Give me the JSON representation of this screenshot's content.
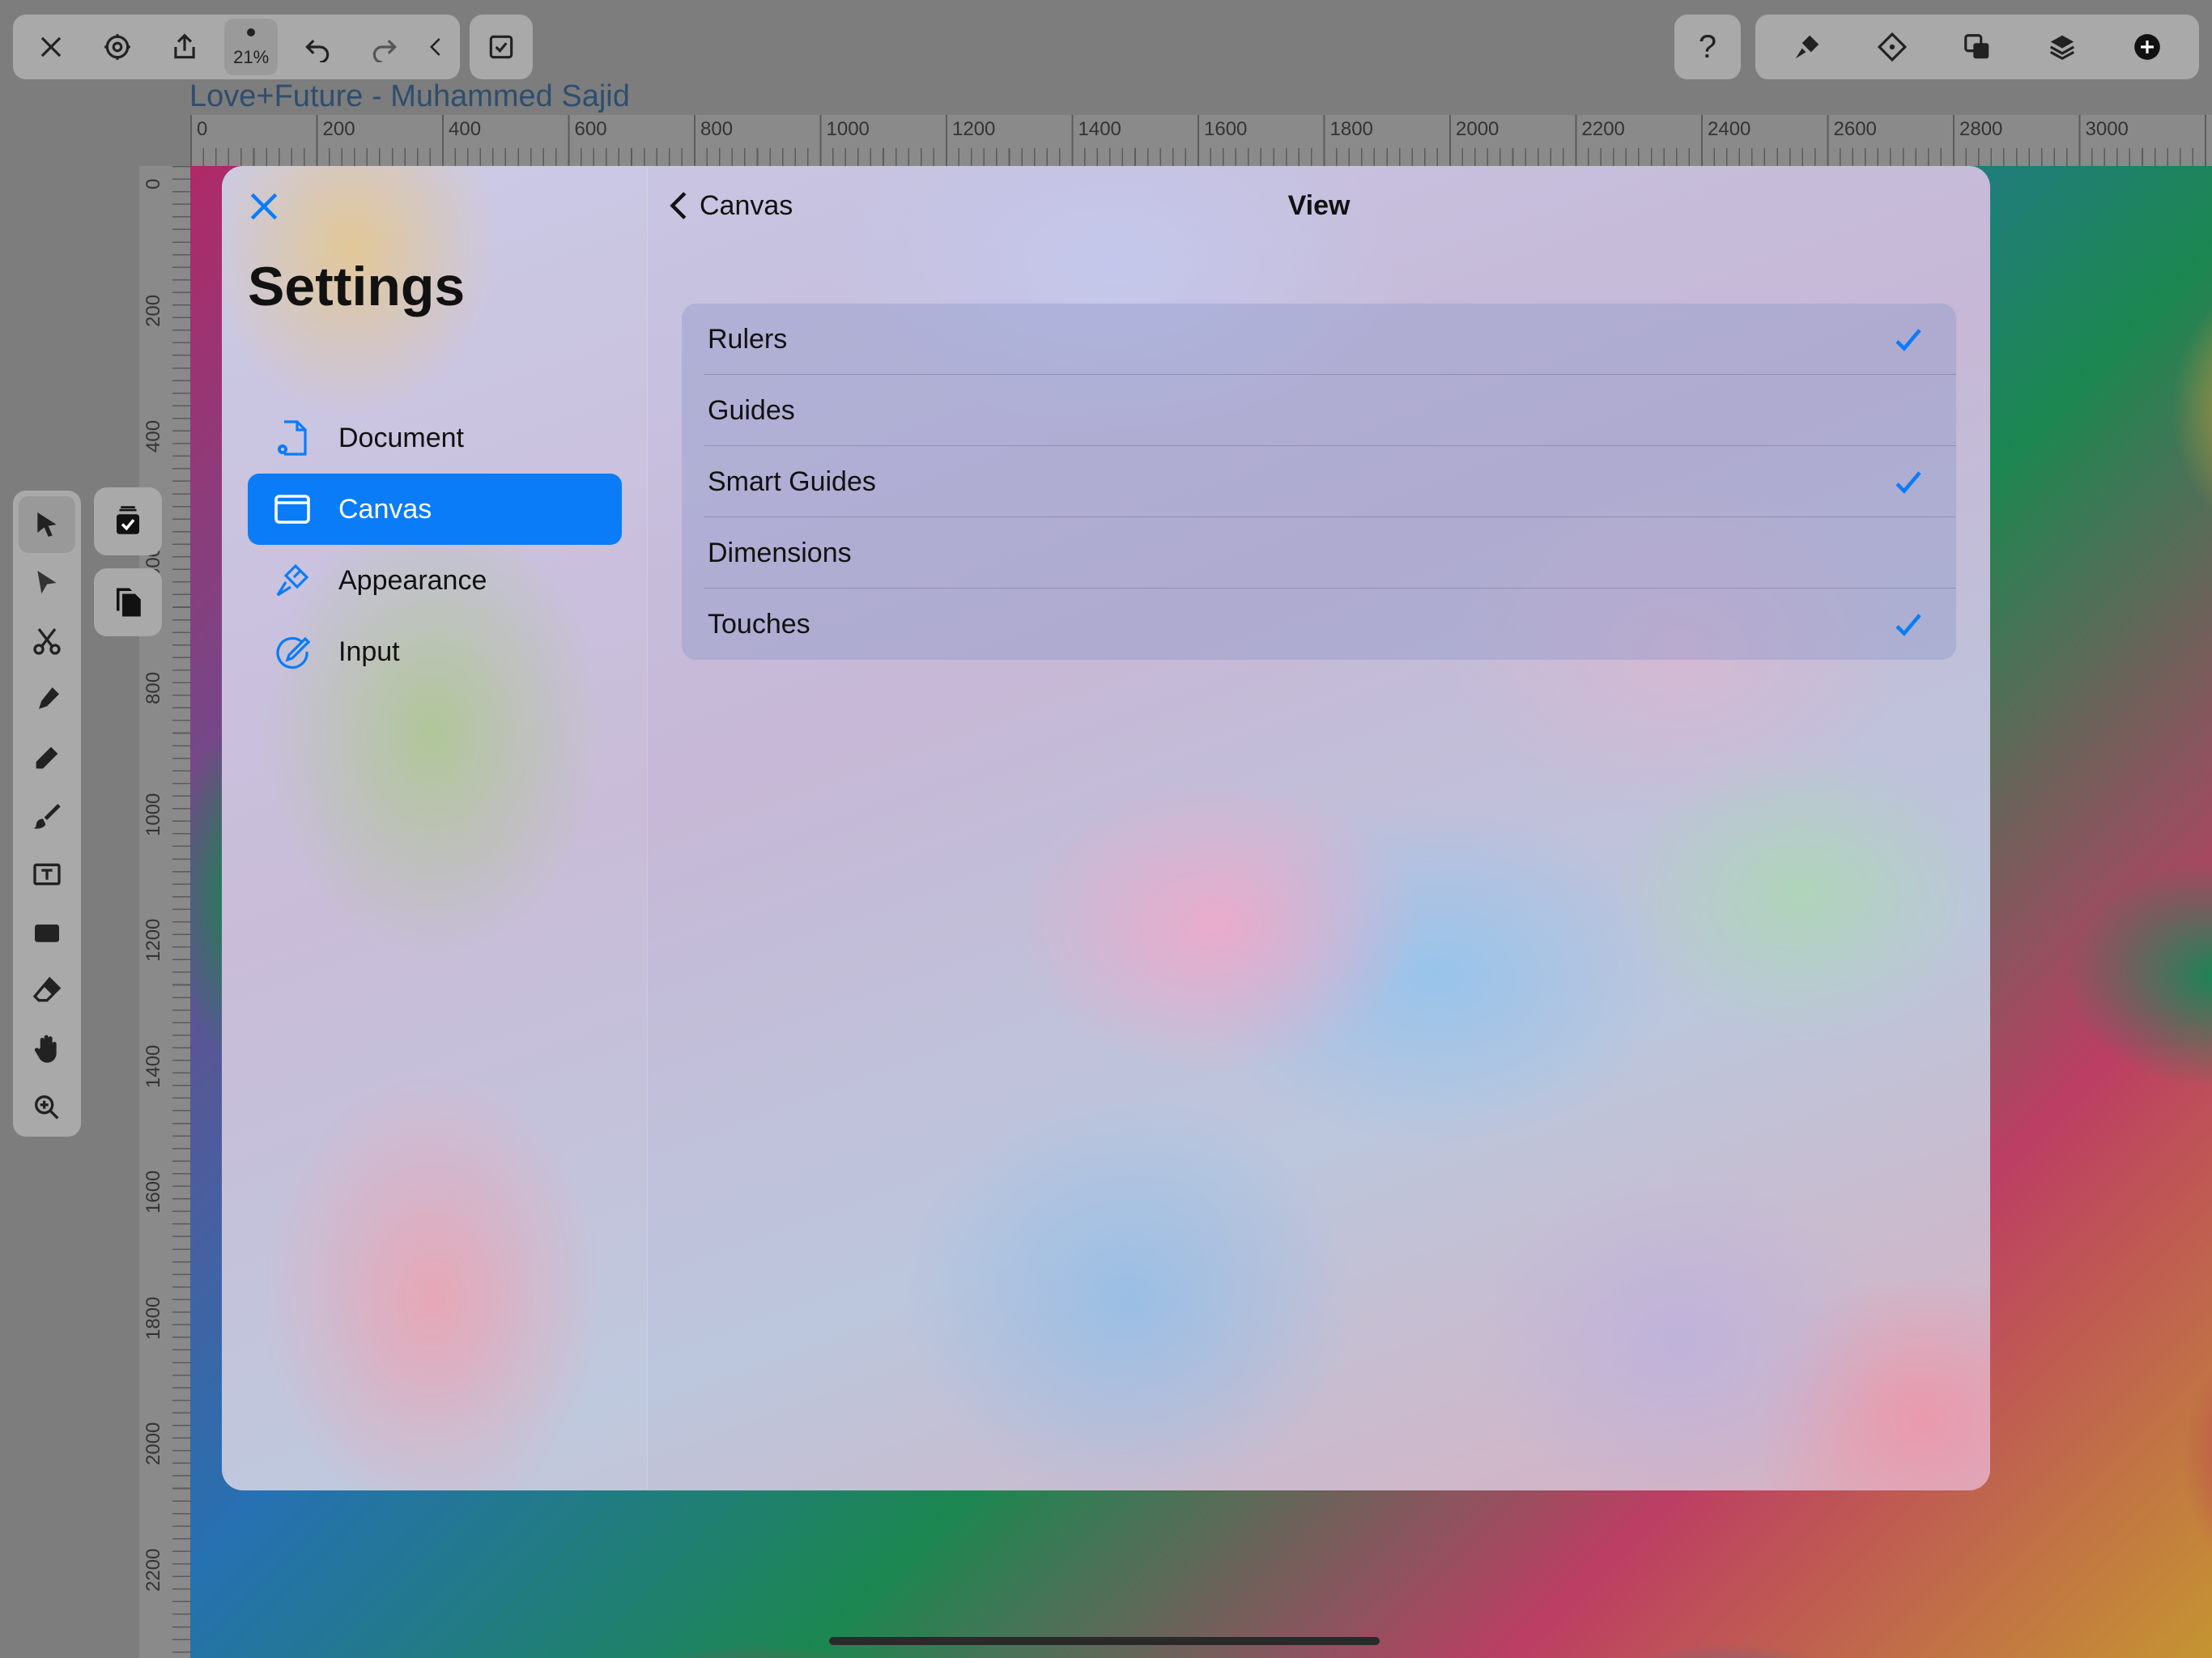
{
  "document_title": "Love+Future - Muhammed Sajid",
  "toolbar": {
    "zoom_label": "21%",
    "help_label": "?"
  },
  "ruler": {
    "horizontal_labels": [
      "0",
      "200",
      "400",
      "600",
      "800",
      "1000",
      "1200",
      "1400",
      "1600",
      "1800",
      "2000",
      "2200",
      "2400",
      "2600",
      "2800",
      "3000"
    ],
    "vertical_labels": [
      "0",
      "200",
      "400",
      "600",
      "800",
      "1000",
      "1200",
      "1400",
      "1600",
      "1800",
      "2000",
      "2200"
    ]
  },
  "settings": {
    "title": "Settings",
    "nav": [
      {
        "label": "Document",
        "icon": "document-gear-icon"
      },
      {
        "label": "Canvas",
        "icon": "canvas-window-icon",
        "selected": true
      },
      {
        "label": "Appearance",
        "icon": "brush-icon"
      },
      {
        "label": "Input",
        "icon": "pencil-circle-icon"
      }
    ],
    "back_label": "Canvas",
    "detail_title": "View",
    "options": [
      {
        "label": "Rulers",
        "checked": true
      },
      {
        "label": "Guides",
        "checked": false
      },
      {
        "label": "Smart Guides",
        "checked": true
      },
      {
        "label": "Dimensions",
        "checked": false
      },
      {
        "label": "Touches",
        "checked": true
      }
    ]
  },
  "colors": {
    "accent": "#0a7cf8",
    "toolbar_bg": "#a9a9a9"
  }
}
